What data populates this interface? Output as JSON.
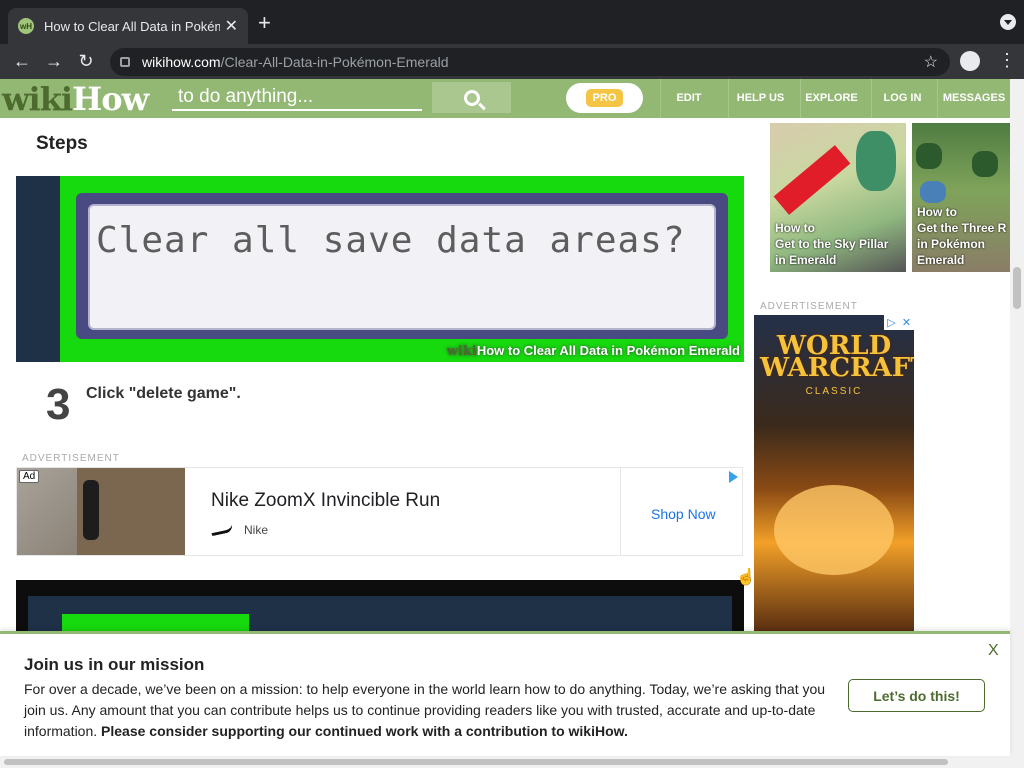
{
  "browser": {
    "tab_title": "How to Clear All Data in Pokémon Emerald",
    "favicon": "wH",
    "new_tab": "+",
    "close": "✕",
    "url_host": "wikihow.com",
    "url_path": "/Clear-All-Data-in-Pokémon-Emerald",
    "back": "←",
    "forward": "→",
    "reload": "↻",
    "bookmark": "☆",
    "menu": "⋮"
  },
  "header": {
    "logo_wiki": "wiki",
    "logo_how": "How",
    "search_placeholder": "to do anything...",
    "pro": "PRO",
    "nav": [
      "EDIT",
      "HELP US",
      "EXPLORE",
      "LOG IN",
      "MESSAGES"
    ]
  },
  "article": {
    "section_title": "Steps",
    "step_image_text": "Clear all save data areas?",
    "watermark_wiki": "wiki",
    "watermark_text": "How to Clear All Data in Pokémon Emerald",
    "step_number": "3",
    "step_text": "Click \"delete game\"."
  },
  "ad_banner": {
    "label": "ADVERTISEMENT",
    "badge": "Ad",
    "title": "Nike ZoomX Invincible Run",
    "brand": "Nike",
    "cta": "Shop Now"
  },
  "sidebar": {
    "related": [
      {
        "caption_lines": [
          "How to",
          "Get to the Sky Pillar",
          "in Emerald"
        ]
      },
      {
        "caption_lines": [
          "How to",
          "Get the Three R",
          "in Pokémon",
          "Emerald"
        ]
      }
    ],
    "ad_label": "ADVERTISEMENT",
    "ad_title_line1": "WORLD",
    "ad_title_line2": "WARCRAFT",
    "ad_subtitle": "CLASSIC",
    "ad_choice": "▷",
    "ad_close": "✕"
  },
  "mission": {
    "title": "Join us in our mission",
    "body": "For over a decade, we’ve been on a mission: to help everyone in the world learn how to do anything. Today, we’re asking that you join us. Any amount that you can contribute helps us to continue providing readers like you with trusted, accurate and up-to-date information. ",
    "body_bold": "Please consider supporting our continued work with a contribution to wikiHow.",
    "button": "Let’s do this!",
    "close": "X"
  },
  "colors": {
    "wikihow_green": "#93b874",
    "wikihow_dark_green": "#4d6b2e",
    "pro_yellow": "#f4c445",
    "link_blue": "#1a73e8"
  }
}
